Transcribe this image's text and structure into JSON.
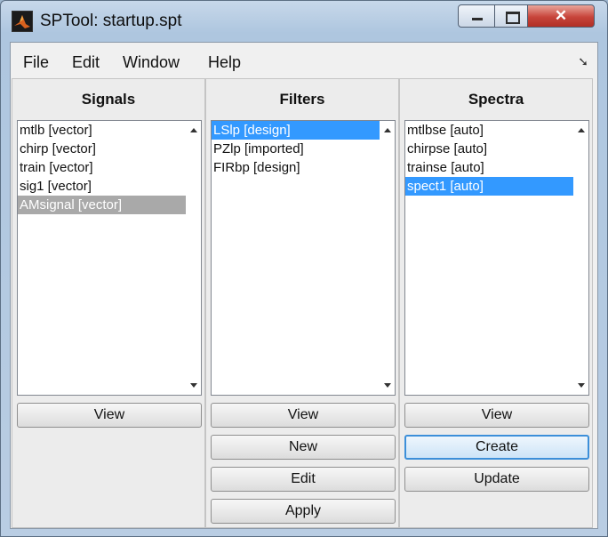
{
  "window": {
    "title": "SPTool: startup.spt"
  },
  "menu": [
    "File",
    "Edit",
    "Window",
    "Help"
  ],
  "icons": {
    "app": "matlab-logo-icon",
    "dock": "dock-arrow-icon",
    "minimize": "minimize-icon",
    "maximize": "maximize-icon",
    "close": "close-icon"
  },
  "signals": {
    "title": "Signals",
    "items": [
      "mtlb [vector]",
      "chirp [vector]",
      "train [vector]",
      "sig1 [vector]",
      "AMsignal [vector]"
    ],
    "selected": "AMsignal [vector]",
    "buttons": {
      "view": "View"
    }
  },
  "filters": {
    "title": "Filters",
    "items": [
      "LSlp [design]",
      "PZlp [imported]",
      "FIRbp [design]"
    ],
    "selected": "LSlp [design]",
    "buttons": {
      "view": "View",
      "new": "New",
      "edit": "Edit",
      "apply": "Apply"
    }
  },
  "spectra": {
    "title": "Spectra",
    "items": [
      "mtlbse [auto]",
      "chirpse [auto]",
      "trainse [auto]",
      "spect1 [auto]"
    ],
    "selected": "spect1 [auto]",
    "buttons": {
      "view": "View",
      "create": "Create",
      "update": "Update"
    }
  },
  "colors": {
    "selection": "#3399ff",
    "inactive_selection": "#a9a9a9",
    "close_button": "#c7443a"
  }
}
